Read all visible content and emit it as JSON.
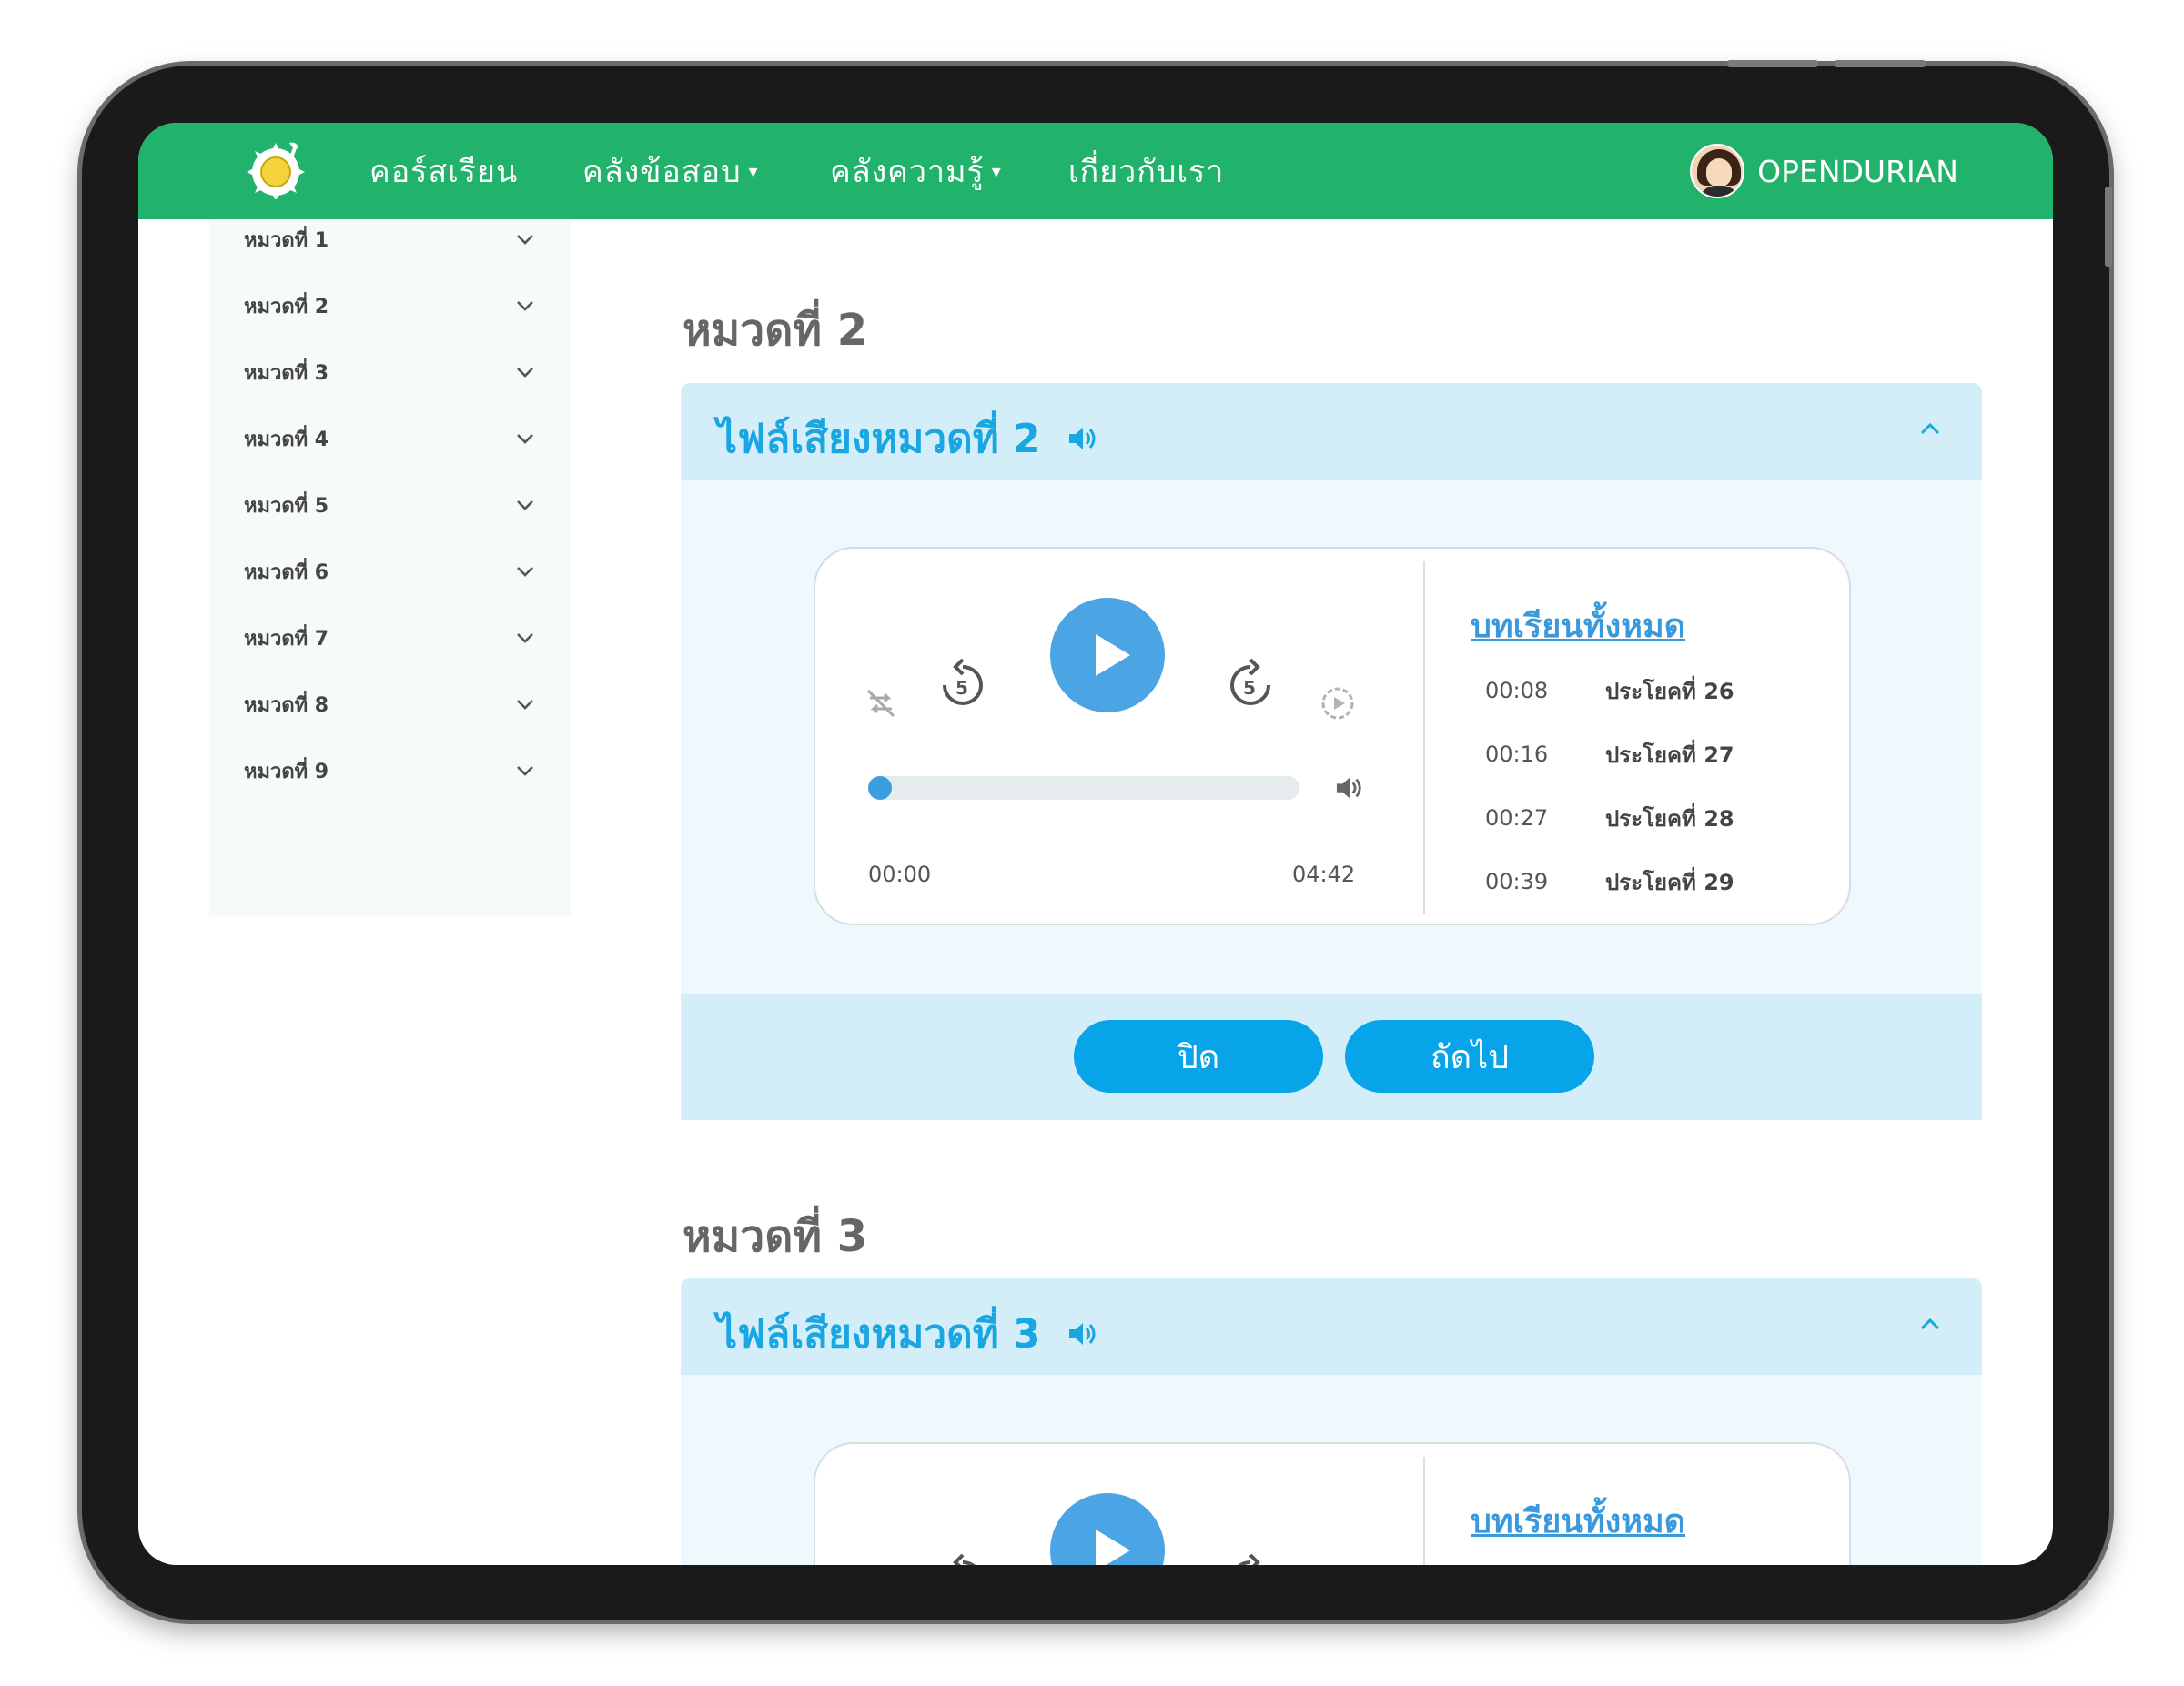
{
  "nav": {
    "items": [
      {
        "label": "คอร์สเรียน",
        "caret": ""
      },
      {
        "label": "คลังข้อสอบ",
        "caret": "▾"
      },
      {
        "label": "คลังความรู้",
        "caret": "▾"
      },
      {
        "label": "เกี่ยวกับเรา",
        "caret": ""
      }
    ],
    "user_name": "OPENDURIAN"
  },
  "sidebar": {
    "items": [
      {
        "label": "หมวดที่ 1"
      },
      {
        "label": "หมวดที่ 2"
      },
      {
        "label": "หมวดที่ 3"
      },
      {
        "label": "หมวดที่ 4"
      },
      {
        "label": "หมวดที่ 5"
      },
      {
        "label": "หมวดที่ 6"
      },
      {
        "label": "หมวดที่ 7"
      },
      {
        "label": "หมวดที่ 8"
      },
      {
        "label": "หมวดที่ 9"
      }
    ]
  },
  "sections": [
    {
      "title": "หมวดที่ 2",
      "audio_title": "ไฟล์เสียงหมวดที่ 2",
      "player": {
        "current_time": "00:00",
        "duration": "04:42",
        "progress_percent": 0,
        "lessons_link": "บทเรียนทั้งหมด",
        "lessons": [
          {
            "time": "00:08",
            "title": "ประโยคที่ 26"
          },
          {
            "time": "00:16",
            "title": "ประโยคที่ 27"
          },
          {
            "time": "00:27",
            "title": "ประโยคที่ 28"
          },
          {
            "time": "00:39",
            "title": "ประโยคที่ 29"
          }
        ]
      },
      "buttons": {
        "close": "ปิด",
        "next": "ถัดไป"
      }
    },
    {
      "title": "หมวดที่ 3",
      "audio_title": "ไฟล์เสียงหมวดที่ 3",
      "player": {
        "lessons_link": "บทเรียนทั้งหมด"
      }
    }
  ],
  "icons": {
    "logo": "durian-logo-icon",
    "speaker": "speaker-icon",
    "chevron": "chevron-down-icon",
    "caret_up": "chevron-up-icon",
    "rewind": "rewind-5-icon",
    "forward": "forward-5-icon",
    "shuffle": "repeat-off-icon",
    "autoplay": "autoplay-icon"
  },
  "colors": {
    "brand_green": "#21b36b",
    "accent_blue": "#07a4e9",
    "header_blue": "#d3eef9",
    "play_blue": "#4ba4e3"
  }
}
